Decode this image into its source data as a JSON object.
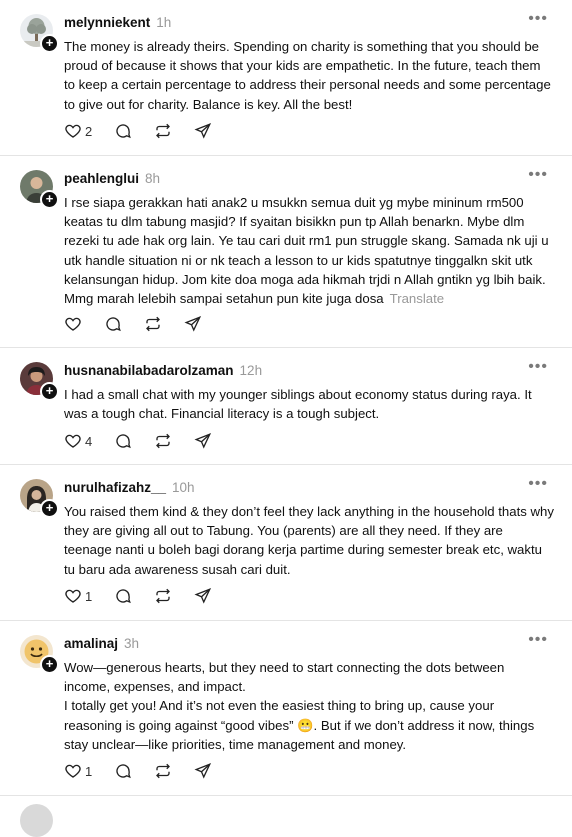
{
  "posts": [
    {
      "username": "melynniekent",
      "time": "1h",
      "avatar_icon": "tree-avatar",
      "text": "The money is already theirs. Spending on charity is something that you should be proud of because it shows that your kids are empathetic. In the future, teach them to keep a certain percentage to address their personal needs and some percentage to give out for charity. Balance is key. All the best!",
      "likes": "2",
      "translate": ""
    },
    {
      "username": "peahlenglui",
      "time": "8h",
      "avatar_icon": "person-avatar",
      "text": "I rse siapa gerakkan hati anak2 u msukkn semua duit yg mybe mininum rm500 keatas tu dlm tabung masjid? If syaitan bisikkn pun tp Allah benarkn. Mybe dlm rezeki tu ade hak org lain. Ye tau cari duit rm1 pun struggle skang. Samada nk uji u utk handle situation ni or nk teach a lesson to ur kids spatutnye tinggalkn skit utk kelansungan hidup. Jom kite doa moga ada hikmah trjdi n Allah gntikn yg lbih baik. Mmg marah lelebih sampai setahun pun kite juga dosa",
      "likes": "",
      "translate": "Translate"
    },
    {
      "username": "husnanabilabadarolzaman",
      "time": "12h",
      "avatar_icon": "person-avatar",
      "text": "I had a small chat with my younger siblings about economy status during raya. It was a tough chat. Financial literacy is a tough subject.",
      "likes": "4",
      "translate": ""
    },
    {
      "username": "nurulhafizahz__",
      "time": "10h",
      "avatar_icon": "person-avatar",
      "text": "You raised them kind & they don’t feel they lack anything in the household thats why they are giving all out to Tabung. You (parents) are all they need. If they are teenage nanti u boleh bagi dorang kerja partime during semester break etc, waktu tu baru ada awareness susah cari duit.",
      "likes": "1",
      "translate": ""
    },
    {
      "username": "amalinaj",
      "time": "3h",
      "avatar_icon": "emoji-avatar",
      "text_lines": [
        "Wow—generous hearts, but they need to start connecting the dots between income, expenses, and impact.",
        "I totally get you! And it’s not even the easiest thing to bring up, cause your reasoning is going against “good vibes” 😬. But if we don’t address it now, things stay unclear—like priorities, time management and money."
      ],
      "likes": "1",
      "translate": ""
    }
  ],
  "icons": {
    "more": "more-icon",
    "like": "heart-icon",
    "reply": "comment-icon",
    "repost": "repost-icon",
    "share": "send-icon",
    "follow": "plus-icon"
  }
}
